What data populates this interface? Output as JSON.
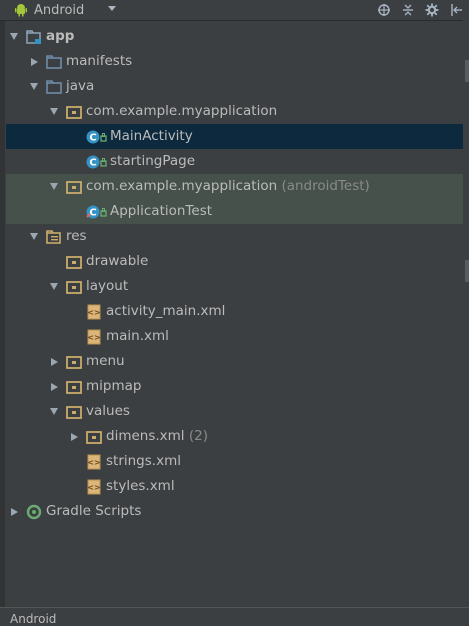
{
  "toolbar": {
    "title": "Android",
    "icons": [
      "android-icon",
      "target-icon",
      "collapse-icon",
      "gear-icon",
      "hide-icon"
    ]
  },
  "tree": [
    {
      "label": "app",
      "bold": true,
      "icon": "module",
      "arrow": "down",
      "level": 0
    },
    {
      "label": "manifests",
      "icon": "folder",
      "arrow": "right",
      "level": 1
    },
    {
      "label": "java",
      "icon": "folder",
      "arrow": "down",
      "level": 1
    },
    {
      "label": "com.example.myapplication",
      "icon": "package",
      "arrow": "down",
      "level": 2
    },
    {
      "label": "MainActivity",
      "icon": "class",
      "arrow": "",
      "level": 3,
      "state": "selected"
    },
    {
      "label": "startingPage",
      "icon": "class",
      "arrow": "",
      "level": 3
    },
    {
      "label": "com.example.myapplication",
      "extra": "(androidTest)",
      "icon": "package",
      "arrow": "down",
      "level": 2,
      "state": "test"
    },
    {
      "label": "ApplicationTest",
      "icon": "class-test",
      "arrow": "",
      "level": 3,
      "state": "test"
    },
    {
      "label": "res",
      "icon": "res",
      "arrow": "down",
      "level": 1
    },
    {
      "label": "drawable",
      "icon": "package",
      "arrow": "",
      "level": 2
    },
    {
      "label": "layout",
      "icon": "package",
      "arrow": "down",
      "level": 2
    },
    {
      "label": "activity_main.xml",
      "icon": "xml",
      "arrow": "",
      "level": 3
    },
    {
      "label": "main.xml",
      "icon": "xml",
      "arrow": "",
      "level": 3
    },
    {
      "label": "menu",
      "icon": "package",
      "arrow": "right",
      "level": 2
    },
    {
      "label": "mipmap",
      "icon": "package",
      "arrow": "right",
      "level": 2
    },
    {
      "label": "values",
      "icon": "package",
      "arrow": "down",
      "level": 2
    },
    {
      "label": "dimens.xml",
      "extra": "(2)",
      "icon": "package",
      "arrow": "right",
      "level": 3
    },
    {
      "label": "strings.xml",
      "icon": "xml",
      "arrow": "",
      "level": 3
    },
    {
      "label": "styles.xml",
      "icon": "xml",
      "arrow": "",
      "level": 3
    },
    {
      "label": "Gradle Scripts",
      "icon": "gradle",
      "arrow": "right",
      "level": 0
    }
  ],
  "status": {
    "label": "Android"
  },
  "colors": {
    "background": "#3c3f41",
    "selected": "#0d293e",
    "test": "#45514a",
    "text": "#bbbbbb"
  }
}
